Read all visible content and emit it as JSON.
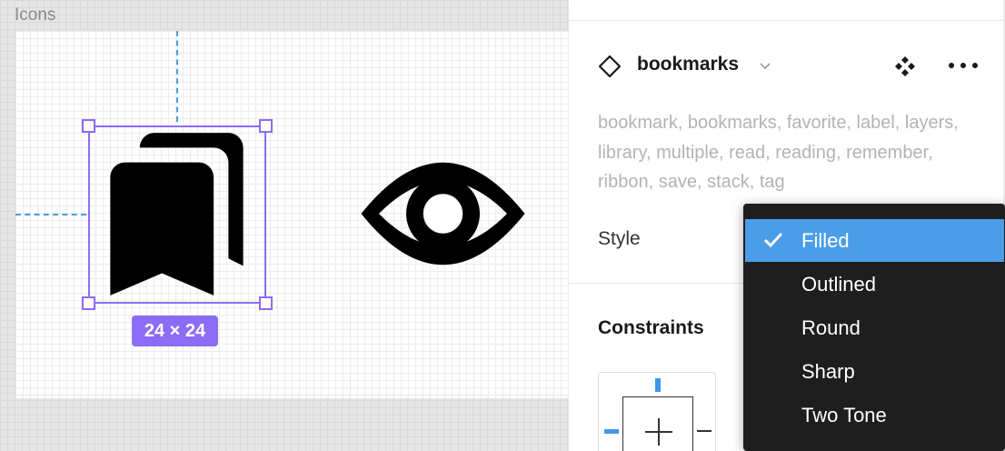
{
  "canvas": {
    "frame_label": "Icons",
    "selection_size": "24 × 24",
    "icons": [
      "bookmarks-icon",
      "eye-icon"
    ]
  },
  "panel": {
    "component": {
      "name": "bookmarks",
      "icon": "component-diamond-icon"
    },
    "keywords": "bookmark, bookmarks, favorite, label, layers, library, multiple, read, reading, remember, ribbon, save, stack, tag",
    "style_label": "Style",
    "constraints_title": "Constraints"
  },
  "dropdown": {
    "items": [
      {
        "label": "Filled",
        "selected": true
      },
      {
        "label": "Outlined",
        "selected": false
      },
      {
        "label": "Round",
        "selected": false
      },
      {
        "label": "Sharp",
        "selected": false
      },
      {
        "label": "Two Tone",
        "selected": false
      }
    ]
  },
  "colors": {
    "selection": "#8b6df5",
    "guide": "#4a9fe0",
    "menu_bg": "#1e1e1e",
    "menu_highlight": "#4c9de8"
  }
}
